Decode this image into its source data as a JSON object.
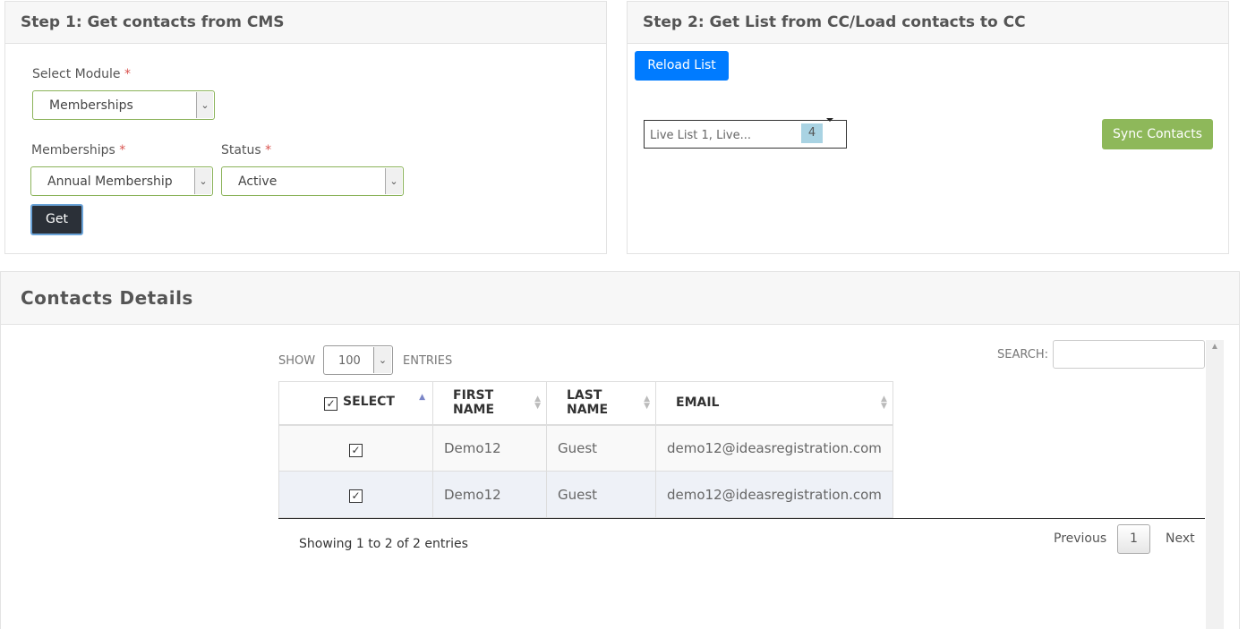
{
  "step1": {
    "title": "Step 1: Get contacts from CMS",
    "module_label": "Select Module",
    "module_value": "Memberships",
    "memberships_label": "Memberships",
    "memberships_value": "Annual Membership",
    "status_label": "Status",
    "status_value": "Active",
    "required_mark": "*",
    "get_label": "Get"
  },
  "step2": {
    "title": "Step 2: Get List from CC/Load contacts to CC",
    "reload_label": "Reload List",
    "list_value": "Live List 1, Live...",
    "list_count": "4",
    "sync_label": "Sync Contacts"
  },
  "contacts": {
    "title": "Contacts Details",
    "show_label": "Show",
    "entries_label": "entries",
    "page_length": "100",
    "search_label": "Search:",
    "search_value": "",
    "columns": [
      "Select",
      "First Name",
      "Last Name",
      "Email"
    ],
    "rows": [
      {
        "first": "Demo12",
        "last": "Guest",
        "email": "demo12@ideasregistration.com",
        "checked": true
      },
      {
        "first": "Demo12",
        "last": "Guest",
        "email": "demo12@ideasregistration.com",
        "checked": true
      }
    ],
    "info": "Showing 1 to 2 of 2 entries",
    "prev_label": "Previous",
    "page": "1",
    "next_label": "Next"
  },
  "icons": {
    "caret": "chevron-down-icon",
    "check": "checkbox-checked-icon",
    "sort": "sort-icon"
  },
  "colors": {
    "primary": "#007bff",
    "success": "#8eb85a",
    "dark": "#2b3038",
    "required": "#d9534f",
    "badge": "#a9d3e3"
  }
}
